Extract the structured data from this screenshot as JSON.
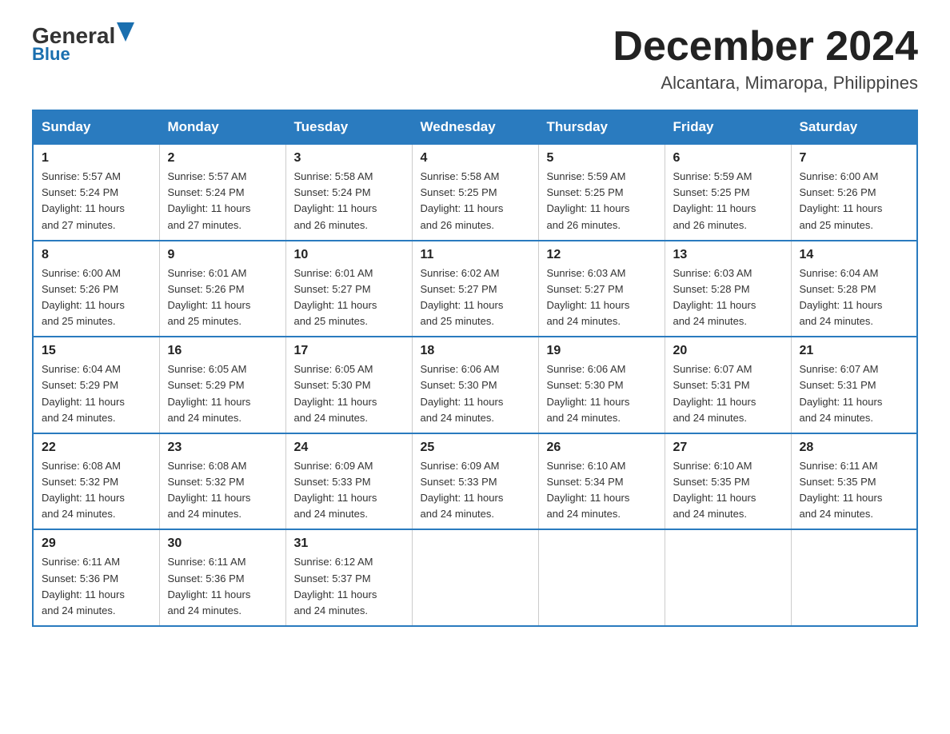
{
  "logo": {
    "general": "General",
    "blue": "Blue"
  },
  "header": {
    "title": "December 2024",
    "subtitle": "Alcantara, Mimaropa, Philippines"
  },
  "days_of_week": [
    "Sunday",
    "Monday",
    "Tuesday",
    "Wednesday",
    "Thursday",
    "Friday",
    "Saturday"
  ],
  "weeks": [
    [
      {
        "day": "1",
        "sunrise": "5:57 AM",
        "sunset": "5:24 PM",
        "daylight": "11 hours and 27 minutes."
      },
      {
        "day": "2",
        "sunrise": "5:57 AM",
        "sunset": "5:24 PM",
        "daylight": "11 hours and 27 minutes."
      },
      {
        "day": "3",
        "sunrise": "5:58 AM",
        "sunset": "5:24 PM",
        "daylight": "11 hours and 26 minutes."
      },
      {
        "day": "4",
        "sunrise": "5:58 AM",
        "sunset": "5:25 PM",
        "daylight": "11 hours and 26 minutes."
      },
      {
        "day": "5",
        "sunrise": "5:59 AM",
        "sunset": "5:25 PM",
        "daylight": "11 hours and 26 minutes."
      },
      {
        "day": "6",
        "sunrise": "5:59 AM",
        "sunset": "5:25 PM",
        "daylight": "11 hours and 26 minutes."
      },
      {
        "day": "7",
        "sunrise": "6:00 AM",
        "sunset": "5:26 PM",
        "daylight": "11 hours and 25 minutes."
      }
    ],
    [
      {
        "day": "8",
        "sunrise": "6:00 AM",
        "sunset": "5:26 PM",
        "daylight": "11 hours and 25 minutes."
      },
      {
        "day": "9",
        "sunrise": "6:01 AM",
        "sunset": "5:26 PM",
        "daylight": "11 hours and 25 minutes."
      },
      {
        "day": "10",
        "sunrise": "6:01 AM",
        "sunset": "5:27 PM",
        "daylight": "11 hours and 25 minutes."
      },
      {
        "day": "11",
        "sunrise": "6:02 AM",
        "sunset": "5:27 PM",
        "daylight": "11 hours and 25 minutes."
      },
      {
        "day": "12",
        "sunrise": "6:03 AM",
        "sunset": "5:27 PM",
        "daylight": "11 hours and 24 minutes."
      },
      {
        "day": "13",
        "sunrise": "6:03 AM",
        "sunset": "5:28 PM",
        "daylight": "11 hours and 24 minutes."
      },
      {
        "day": "14",
        "sunrise": "6:04 AM",
        "sunset": "5:28 PM",
        "daylight": "11 hours and 24 minutes."
      }
    ],
    [
      {
        "day": "15",
        "sunrise": "6:04 AM",
        "sunset": "5:29 PM",
        "daylight": "11 hours and 24 minutes."
      },
      {
        "day": "16",
        "sunrise": "6:05 AM",
        "sunset": "5:29 PM",
        "daylight": "11 hours and 24 minutes."
      },
      {
        "day": "17",
        "sunrise": "6:05 AM",
        "sunset": "5:30 PM",
        "daylight": "11 hours and 24 minutes."
      },
      {
        "day": "18",
        "sunrise": "6:06 AM",
        "sunset": "5:30 PM",
        "daylight": "11 hours and 24 minutes."
      },
      {
        "day": "19",
        "sunrise": "6:06 AM",
        "sunset": "5:30 PM",
        "daylight": "11 hours and 24 minutes."
      },
      {
        "day": "20",
        "sunrise": "6:07 AM",
        "sunset": "5:31 PM",
        "daylight": "11 hours and 24 minutes."
      },
      {
        "day": "21",
        "sunrise": "6:07 AM",
        "sunset": "5:31 PM",
        "daylight": "11 hours and 24 minutes."
      }
    ],
    [
      {
        "day": "22",
        "sunrise": "6:08 AM",
        "sunset": "5:32 PM",
        "daylight": "11 hours and 24 minutes."
      },
      {
        "day": "23",
        "sunrise": "6:08 AM",
        "sunset": "5:32 PM",
        "daylight": "11 hours and 24 minutes."
      },
      {
        "day": "24",
        "sunrise": "6:09 AM",
        "sunset": "5:33 PM",
        "daylight": "11 hours and 24 minutes."
      },
      {
        "day": "25",
        "sunrise": "6:09 AM",
        "sunset": "5:33 PM",
        "daylight": "11 hours and 24 minutes."
      },
      {
        "day": "26",
        "sunrise": "6:10 AM",
        "sunset": "5:34 PM",
        "daylight": "11 hours and 24 minutes."
      },
      {
        "day": "27",
        "sunrise": "6:10 AM",
        "sunset": "5:35 PM",
        "daylight": "11 hours and 24 minutes."
      },
      {
        "day": "28",
        "sunrise": "6:11 AM",
        "sunset": "5:35 PM",
        "daylight": "11 hours and 24 minutes."
      }
    ],
    [
      {
        "day": "29",
        "sunrise": "6:11 AM",
        "sunset": "5:36 PM",
        "daylight": "11 hours and 24 minutes."
      },
      {
        "day": "30",
        "sunrise": "6:11 AM",
        "sunset": "5:36 PM",
        "daylight": "11 hours and 24 minutes."
      },
      {
        "day": "31",
        "sunrise": "6:12 AM",
        "sunset": "5:37 PM",
        "daylight": "11 hours and 24 minutes."
      },
      null,
      null,
      null,
      null
    ]
  ],
  "labels": {
    "sunrise_prefix": "Sunrise: ",
    "sunset_prefix": "Sunset: ",
    "daylight_prefix": "Daylight: "
  }
}
